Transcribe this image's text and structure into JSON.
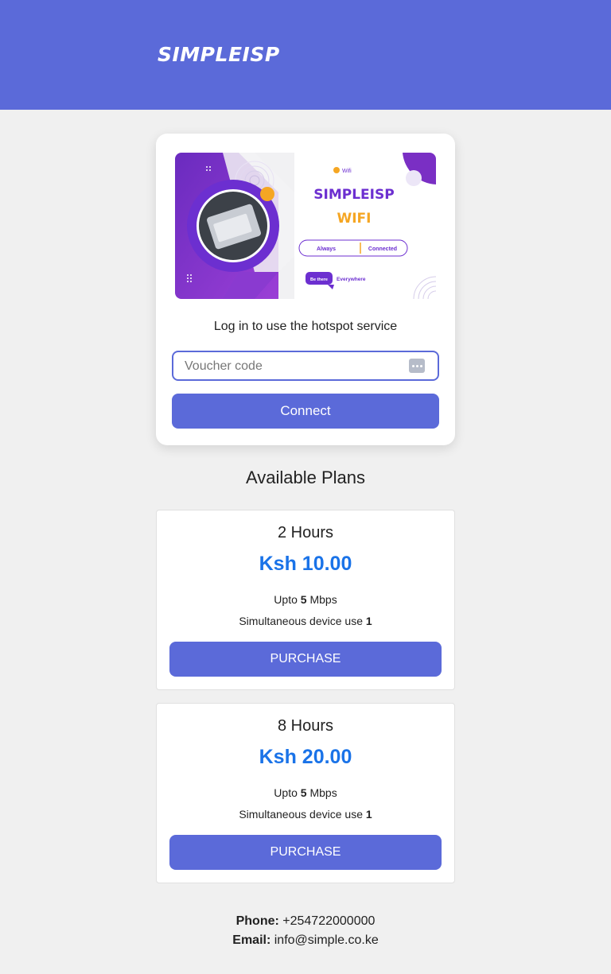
{
  "header": {
    "logo": "SIMPLEISP",
    "bg_color": "#5b6ad9"
  },
  "banner": {
    "wifi_tag": "Wifi",
    "brand": "SIMPLEISP",
    "product": "WIFI",
    "pill_left": "Always",
    "pill_right": "Connected",
    "badge": "Be there",
    "badge_text": "Everywhere"
  },
  "login": {
    "prompt": "Log in to use the hotspot service",
    "voucher_placeholder": "Voucher code",
    "voucher_value": "",
    "connect_label": "Connect"
  },
  "plans": {
    "title": "Available Plans",
    "items": [
      {
        "name": "2 Hours",
        "price": "Ksh 10.00",
        "speed_prefix": "Upto",
        "speed_value": "5",
        "speed_unit": "Mbps",
        "devices_label": "Simultaneous device use",
        "devices_value": "1",
        "purchase_label": "PURCHASE"
      },
      {
        "name": "8 Hours",
        "price": "Ksh 20.00",
        "speed_prefix": "Upto",
        "speed_value": "5",
        "speed_unit": "Mbps",
        "devices_label": "Simultaneous device use",
        "devices_value": "1",
        "purchase_label": "PURCHASE"
      }
    ]
  },
  "contact": {
    "phone_label": "Phone:",
    "phone_value": "+254722000000",
    "email_label": "Email:",
    "email_value": "info@simple.co.ke"
  },
  "colors": {
    "accent": "#5b6ad9",
    "price": "#1a73e8",
    "page_bg": "#f0f0f0"
  }
}
